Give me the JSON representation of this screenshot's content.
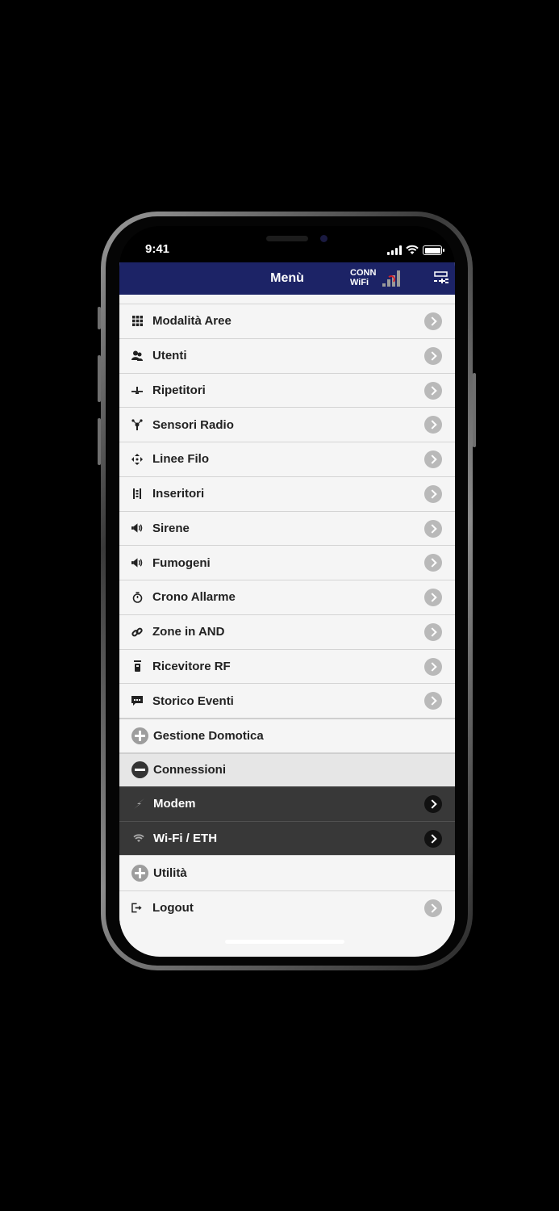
{
  "status_bar": {
    "time": "9:41"
  },
  "header": {
    "title": "Menù",
    "conn_line1": "CONN",
    "conn_line2": "WiFi"
  },
  "menu_items": [
    {
      "label": "Modalità Aree",
      "icon": "grid-icon"
    },
    {
      "label": "Utenti",
      "icon": "users-icon"
    },
    {
      "label": "Ripetitori",
      "icon": "repeater-icon"
    },
    {
      "label": "Sensori Radio",
      "icon": "radio-sensor-icon"
    },
    {
      "label": "Linee Filo",
      "icon": "wired-lines-icon"
    },
    {
      "label": "Inseritori",
      "icon": "keypad-icon"
    },
    {
      "label": "Sirene",
      "icon": "speaker-icon"
    },
    {
      "label": "Fumogeni",
      "icon": "speaker-icon"
    },
    {
      "label": "Crono Allarme",
      "icon": "stopwatch-icon"
    },
    {
      "label": "Zone in AND",
      "icon": "link-icon"
    },
    {
      "label": "Ricevitore RF",
      "icon": "receiver-icon"
    },
    {
      "label": "Storico Eventi",
      "icon": "chat-icon"
    }
  ],
  "groups": {
    "domotica": "Gestione Domotica",
    "connessioni": "Connessioni",
    "utilita": "Utilità"
  },
  "sub_items": [
    {
      "label": "Modem",
      "icon": "lightning-icon"
    },
    {
      "label": "Wi-Fi / ETH",
      "icon": "wifi-icon"
    }
  ],
  "logout": {
    "label": "Logout",
    "icon": "logout-icon"
  },
  "colors": {
    "header": "#1c2366",
    "submenu": "#383838",
    "accent_red": "#d11f2a"
  }
}
